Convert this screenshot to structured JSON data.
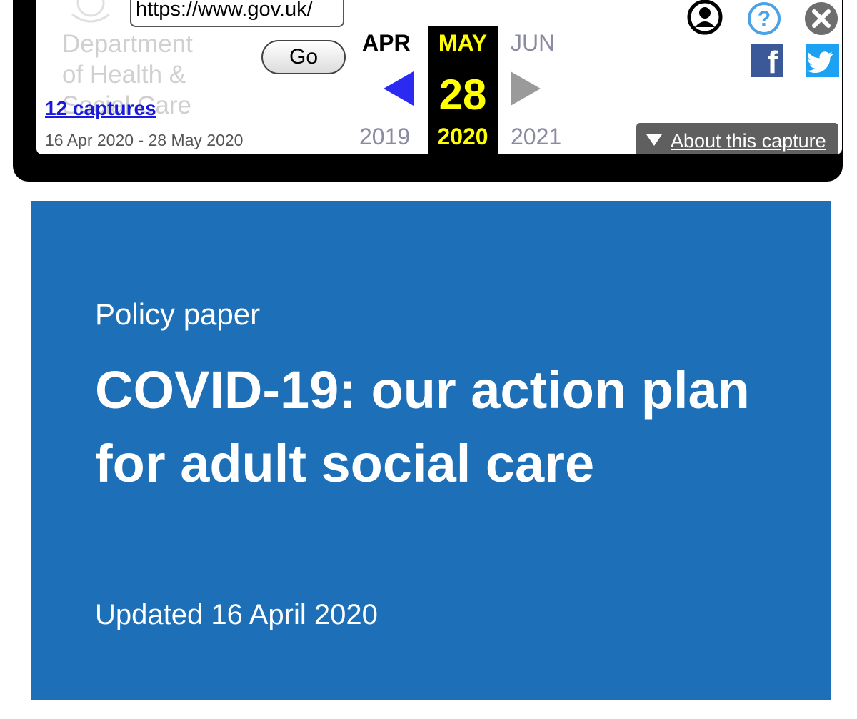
{
  "wayback": {
    "url_value": "https://www.gov.uk/",
    "go_label": "Go",
    "department_lines": [
      "Department",
      "of Health &",
      "Social Care"
    ],
    "captures_link": "12 captures",
    "date_range": "16 Apr 2020 - 28 May 2020",
    "prev_month": "APR",
    "current_month": "MAY",
    "next_month": "JUN",
    "current_day": "28",
    "prev_year": "2019",
    "current_year": "2020",
    "next_year": "2021",
    "about_label": "About this capture",
    "icons": [
      "user-icon",
      "help-icon",
      "close-icon",
      "facebook-icon",
      "twitter-icon",
      "prev-capture-arrow",
      "next-capture-arrow"
    ],
    "colors": {
      "current_highlight": "#ffff00",
      "prev_arrow": "#2a2af0",
      "next_arrow": "#9a9a9a",
      "link": "#1a1adc",
      "facebook": "#3b5998",
      "twitter": "#1da1f2",
      "help": "#4aa3e8"
    }
  },
  "page": {
    "caption": "Policy paper",
    "title": "COVID-19: our action plan for adult social care",
    "updated": "Updated 16 April 2020",
    "colors": {
      "hero_bg": "#1d70b8",
      "hero_text": "#ffffff"
    }
  }
}
